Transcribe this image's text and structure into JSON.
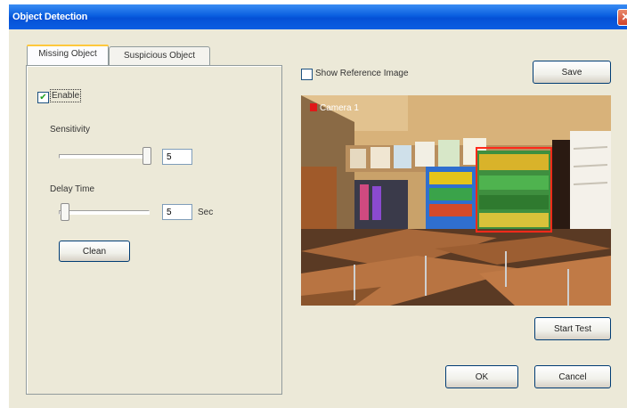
{
  "window": {
    "title": "Object Detection",
    "close_glyph": "✕"
  },
  "tabs": [
    {
      "label": "Missing Object",
      "active": true
    },
    {
      "label": "Suspicious Object",
      "active": false
    }
  ],
  "enable": {
    "label": "Enable",
    "checked": true,
    "check_glyph": "✔"
  },
  "sensitivity": {
    "label": "Sensitivity",
    "value": "5",
    "slider_fraction": 1.0
  },
  "delay": {
    "label": "Delay Time",
    "value": "5",
    "unit": "Sec",
    "slider_fraction": 0.0
  },
  "clean_button": "Clean",
  "show_reference": {
    "label": "Show Reference Image",
    "checked": false
  },
  "save_button": "Save",
  "camera": {
    "label": "Camera 1",
    "flag_color": "#e01818"
  },
  "detection_box_color": "#ff2a1a",
  "start_test_button": "Start Test",
  "ok_button": "OK",
  "cancel_button": "Cancel",
  "colors": {
    "titlebar": "#0550d6",
    "dialog_bg": "#ece9d8",
    "tab_highlight": "#ffc83c"
  }
}
